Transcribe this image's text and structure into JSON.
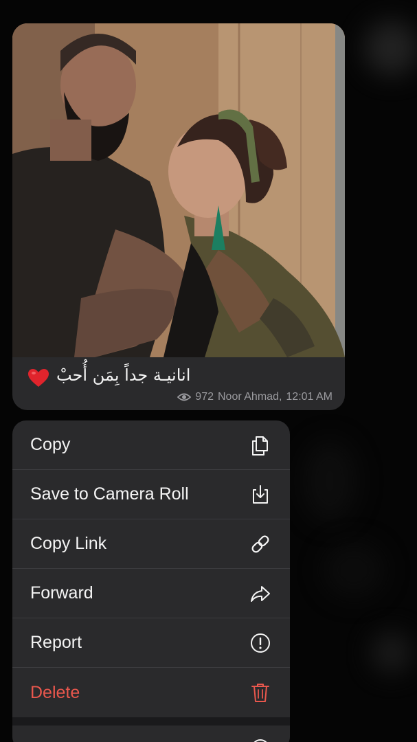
{
  "message": {
    "caption": "انانيـة جداً بِمَن أُحبْ",
    "views": "972",
    "author": "Noor Ahmad,",
    "time": "12:01 AM",
    "photo": "couple-photo"
  },
  "menu": {
    "items": [
      {
        "label": "Copy",
        "icon": "copy-icon"
      },
      {
        "label": "Save to Camera Roll",
        "icon": "save-download-icon"
      },
      {
        "label": "Copy Link",
        "icon": "link-icon"
      },
      {
        "label": "Forward",
        "icon": "forward-arrow-icon"
      },
      {
        "label": "Report",
        "icon": "report-exclamation-icon"
      },
      {
        "label": "Delete",
        "icon": "trash-icon"
      }
    ],
    "danger_color": "#e9574d"
  },
  "colors": {
    "background": "#050505",
    "panel": "#2a2a2c",
    "meta_text": "#9a9a9e",
    "heart": "#e0242c"
  }
}
